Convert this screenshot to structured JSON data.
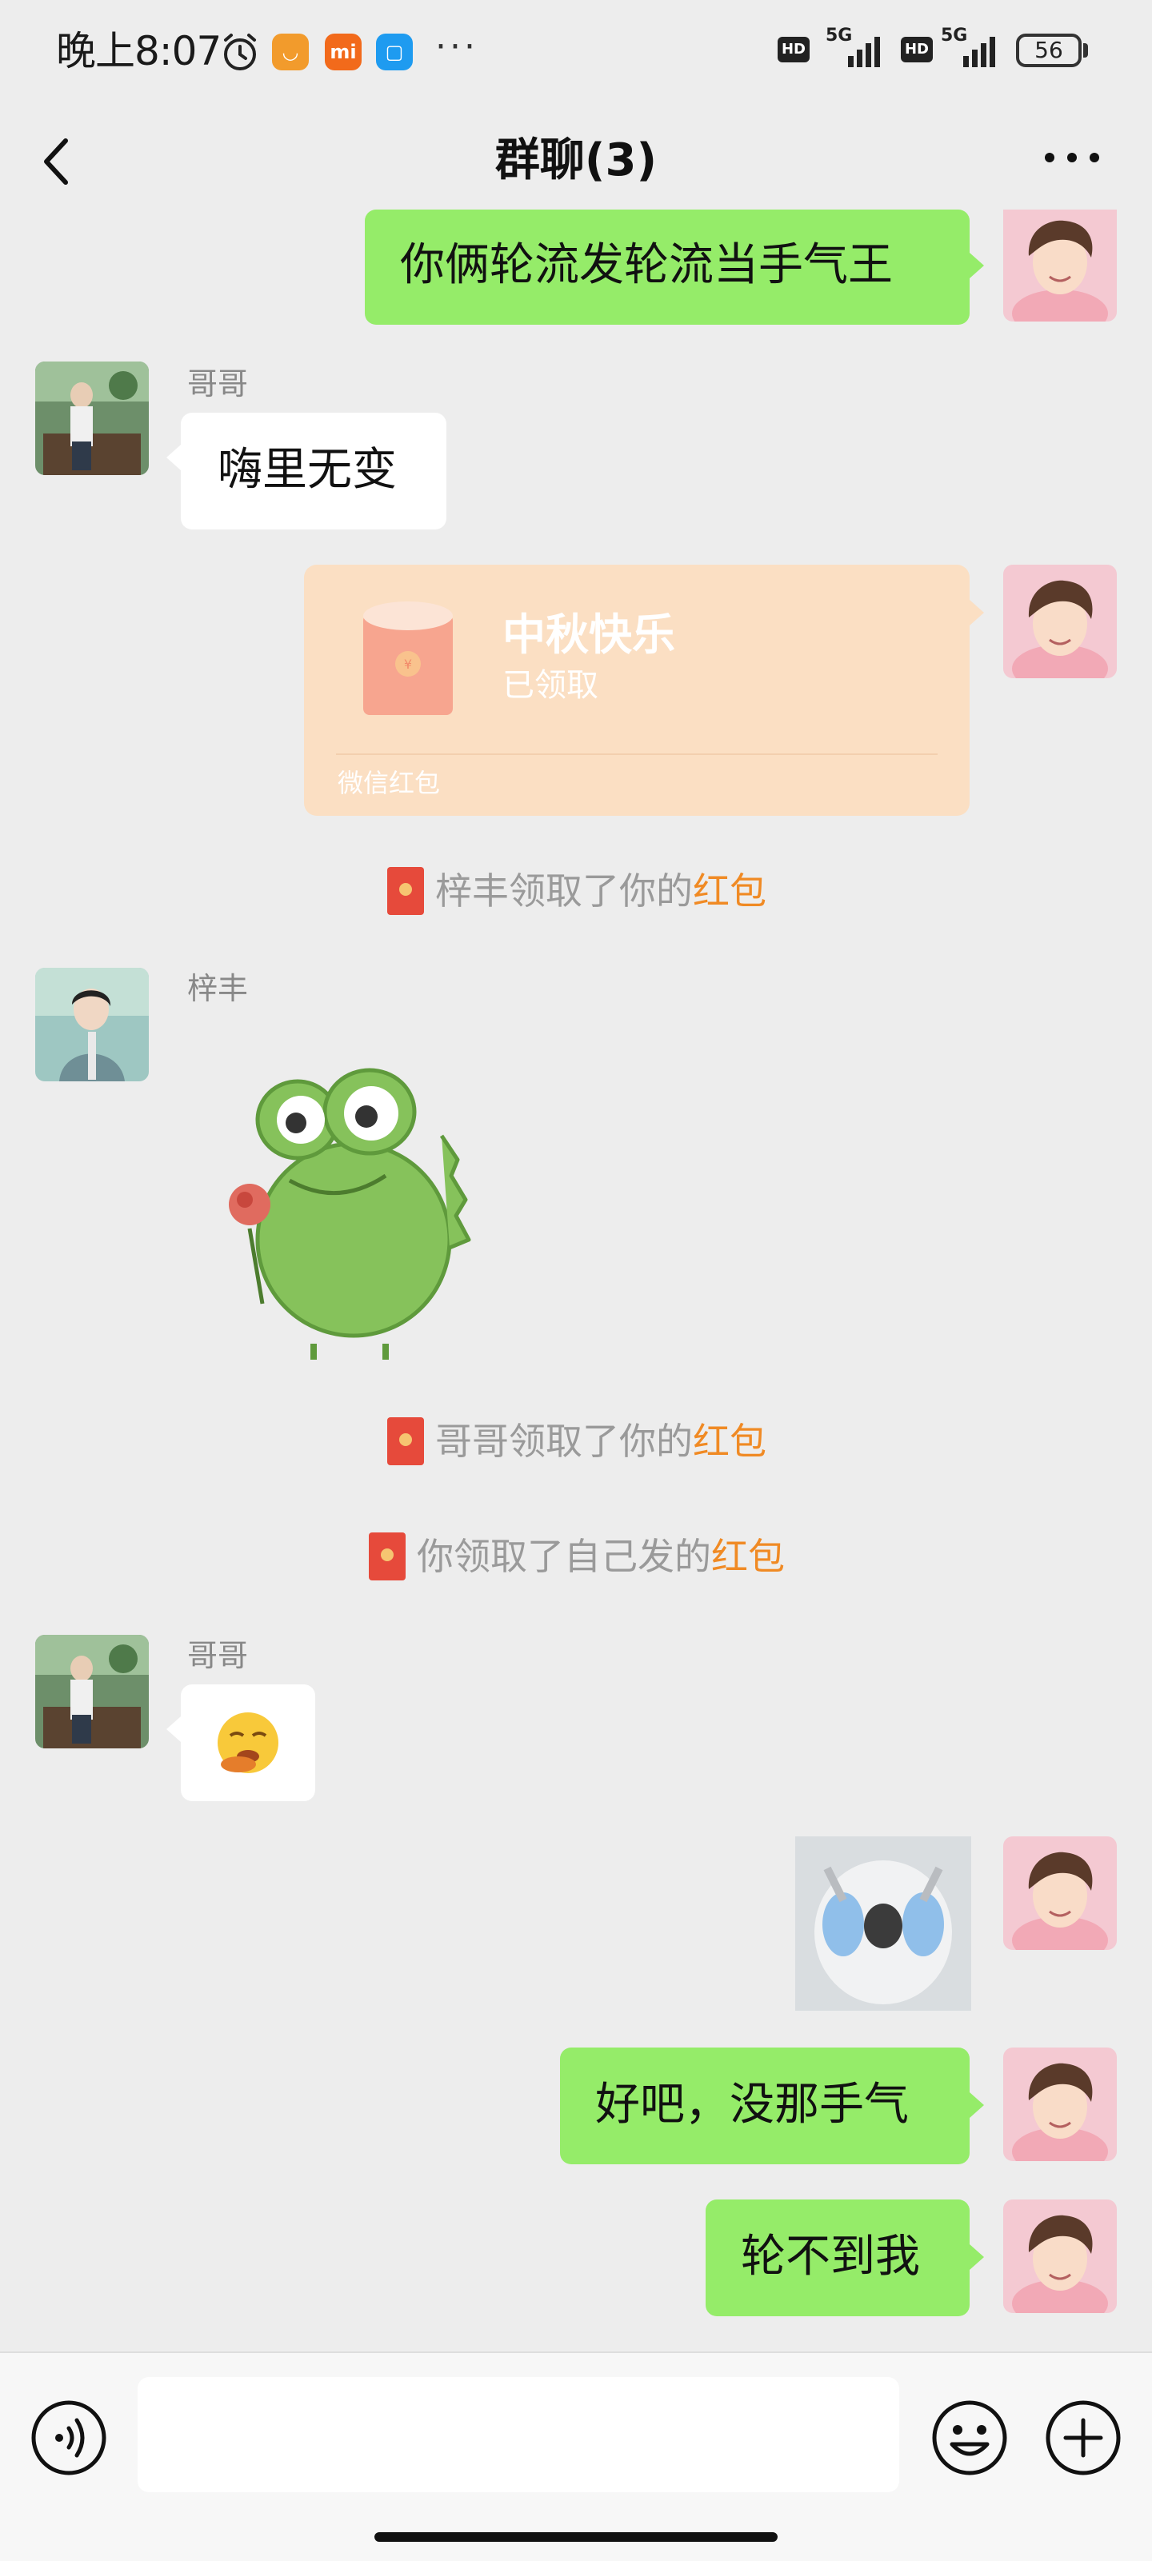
{
  "status_bar": {
    "time": "晚上8:07",
    "network_1": "5G",
    "network_2": "5G",
    "hd_label": "HD",
    "battery": "56",
    "app_icons": [
      "xiaoai-icon",
      "mi-icon",
      "app-icon"
    ],
    "more": "···"
  },
  "nav": {
    "title": "群聊(3)",
    "back_icon": "chevron-left-icon",
    "more_icon": "more-dots-icon"
  },
  "messages": {
    "m1": {
      "text": "你俩轮流发轮流当手气王"
    },
    "m2": {
      "sender": "哥哥",
      "text": "嗨里无变"
    },
    "red_packet": {
      "title": "中秋快乐",
      "status": "已领取",
      "footer": "微信红包"
    },
    "notice1": {
      "prefix": "梓丰领取了你的",
      "link": "红包"
    },
    "m3": {
      "sender": "梓丰",
      "sticker": "frog-with-rose-sticker"
    },
    "notice2": {
      "prefix": "哥哥领取了你的",
      "link": "红包"
    },
    "notice3": {
      "prefix": "你领取了自己发的",
      "link": "红包"
    },
    "m4": {
      "sender": "哥哥",
      "emoji": "🤤"
    },
    "m5": {
      "image": "crying-cat-sticker"
    },
    "m6": {
      "text": "好吧，没那手气"
    },
    "m7": {
      "text": "轮不到我"
    }
  },
  "input_bar": {
    "placeholder": "",
    "voice_icon": "voice-icon",
    "emoji_icon": "emoji-icon",
    "plus_icon": "plus-icon"
  },
  "colors": {
    "background": "#ededed",
    "my_bubble": "#95ec69",
    "other_bubble": "#ffffff",
    "red_packet": "#fbdfc3",
    "link": "#f08a24"
  }
}
